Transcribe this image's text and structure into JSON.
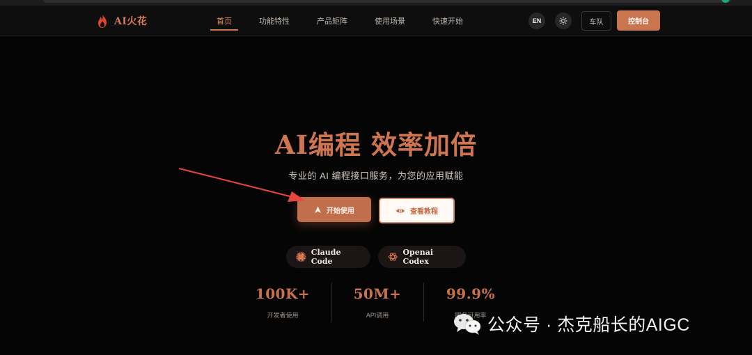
{
  "brand": {
    "name": "AI火花",
    "accent": "#c9754f"
  },
  "nav": {
    "links": [
      {
        "label": "首页",
        "active": true
      },
      {
        "label": "功能特性",
        "active": false
      },
      {
        "label": "产品矩阵",
        "active": false
      },
      {
        "label": "使用场景",
        "active": false
      },
      {
        "label": "快速开始",
        "active": false
      }
    ],
    "lang_label": "EN",
    "theme_icon": "sun-icon",
    "team_label": "车队",
    "console_label": "控制台"
  },
  "hero": {
    "title": "AI编程 效率加倍",
    "subtitle": "专业的 AI 编程接口服务，为您的应用赋能",
    "start_label": "开始使用",
    "start_icon": "rocket-icon",
    "tutorial_label": "查看教程",
    "tutorial_icon": "eye-icon"
  },
  "products": [
    {
      "label": "Claude Code",
      "icon": "claude-spark-icon"
    },
    {
      "label": "Openai Codex",
      "icon": "openai-knot-icon"
    }
  ],
  "stats": [
    {
      "value": "100K+",
      "label": "开发者使用"
    },
    {
      "value": "50M+",
      "label": "API调用"
    },
    {
      "value": "99.9%",
      "label": "服务可用率"
    }
  ],
  "watermark": {
    "text": "公众号 · 杰克船长的AIGC",
    "icon": "wechat-icon"
  }
}
